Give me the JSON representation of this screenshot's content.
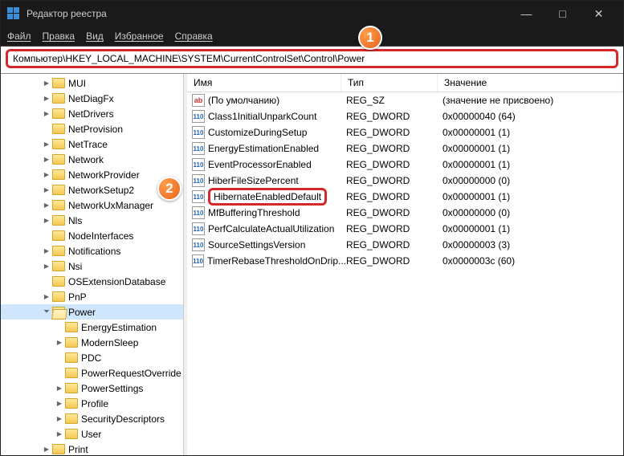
{
  "title": "Редактор реестра",
  "menu": [
    "Файл",
    "Правка",
    "Вид",
    "Избранное",
    "Справка"
  ],
  "address": "Компьютер\\HKEY_LOCAL_MACHINE\\SYSTEM\\CurrentControlSet\\Control\\Power",
  "badge1": "1",
  "badge2": "2",
  "columns": {
    "name": "Имя",
    "type": "Тип",
    "value": "Значение"
  },
  "tree": [
    {
      "depth": 3,
      "exp": ">",
      "label": "MUI"
    },
    {
      "depth": 3,
      "exp": ">",
      "label": "NetDiagFx"
    },
    {
      "depth": 3,
      "exp": ">",
      "label": "NetDrivers"
    },
    {
      "depth": 3,
      "exp": "",
      "label": "NetProvision"
    },
    {
      "depth": 3,
      "exp": ">",
      "label": "NetTrace"
    },
    {
      "depth": 3,
      "exp": ">",
      "label": "Network"
    },
    {
      "depth": 3,
      "exp": ">",
      "label": "NetworkProvider"
    },
    {
      "depth": 3,
      "exp": ">",
      "label": "NetworkSetup2"
    },
    {
      "depth": 3,
      "exp": ">",
      "label": "NetworkUxManager"
    },
    {
      "depth": 3,
      "exp": ">",
      "label": "Nls"
    },
    {
      "depth": 3,
      "exp": "",
      "label": "NodeInterfaces"
    },
    {
      "depth": 3,
      "exp": ">",
      "label": "Notifications"
    },
    {
      "depth": 3,
      "exp": ">",
      "label": "Nsi"
    },
    {
      "depth": 3,
      "exp": "",
      "label": "OSExtensionDatabase"
    },
    {
      "depth": 3,
      "exp": ">",
      "label": "PnP"
    },
    {
      "depth": 3,
      "exp": "v",
      "label": "Power",
      "sel": true,
      "open": true
    },
    {
      "depth": 4,
      "exp": "",
      "label": "EnergyEstimation"
    },
    {
      "depth": 4,
      "exp": ">",
      "label": "ModernSleep"
    },
    {
      "depth": 4,
      "exp": "",
      "label": "PDC"
    },
    {
      "depth": 4,
      "exp": "",
      "label": "PowerRequestOverride"
    },
    {
      "depth": 4,
      "exp": ">",
      "label": "PowerSettings"
    },
    {
      "depth": 4,
      "exp": ">",
      "label": "Profile"
    },
    {
      "depth": 4,
      "exp": ">",
      "label": "SecurityDescriptors"
    },
    {
      "depth": 4,
      "exp": ">",
      "label": "User"
    },
    {
      "depth": 3,
      "exp": ">",
      "label": "Print"
    }
  ],
  "rows": [
    {
      "icon": "str",
      "name": "(По умолчанию)",
      "type": "REG_SZ",
      "value": "(значение не присвоено)"
    },
    {
      "icon": "bin",
      "name": "Class1InitialUnparkCount",
      "type": "REG_DWORD",
      "value": "0x00000040 (64)"
    },
    {
      "icon": "bin",
      "name": "CustomizeDuringSetup",
      "type": "REG_DWORD",
      "value": "0x00000001 (1)"
    },
    {
      "icon": "bin",
      "name": "EnergyEstimationEnabled",
      "type": "REG_DWORD",
      "value": "0x00000001 (1)"
    },
    {
      "icon": "bin",
      "name": "EventProcessorEnabled",
      "type": "REG_DWORD",
      "value": "0x00000001 (1)"
    },
    {
      "icon": "bin",
      "name": "HiberFileSizePercent",
      "type": "REG_DWORD",
      "value": "0x00000000 (0)"
    },
    {
      "icon": "bin",
      "name": "HibernateEnabledDefault",
      "type": "REG_DWORD",
      "value": "0x00000001 (1)",
      "hi": true
    },
    {
      "icon": "bin",
      "name": "MfBufferingThreshold",
      "type": "REG_DWORD",
      "value": "0x00000000 (0)"
    },
    {
      "icon": "bin",
      "name": "PerfCalculateActualUtilization",
      "type": "REG_DWORD",
      "value": "0x00000001 (1)"
    },
    {
      "icon": "bin",
      "name": "SourceSettingsVersion",
      "type": "REG_DWORD",
      "value": "0x00000003 (3)"
    },
    {
      "icon": "bin",
      "name": "TimerRebaseThresholdOnDrip...",
      "type": "REG_DWORD",
      "value": "0x0000003c (60)"
    }
  ]
}
